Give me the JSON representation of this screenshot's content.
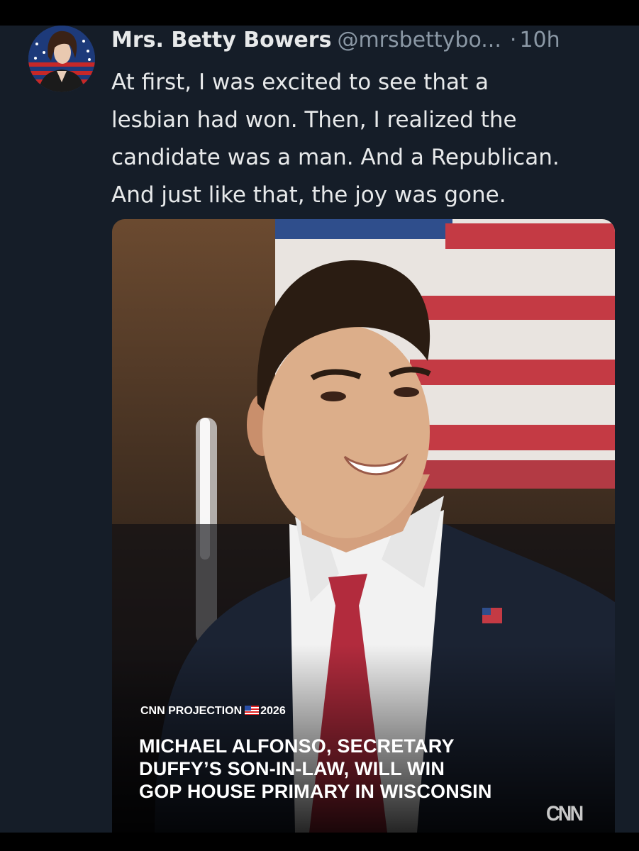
{
  "tweet": {
    "author": {
      "display_name": "Mrs. Betty Bowers",
      "handle": "@mrsbettybo...",
      "separator": "·",
      "time": "10h"
    },
    "text_lines": [
      "At first, I was excited to see that a",
      "lesbian had won. Then, I realized the",
      "candidate was a man. And a Republican.",
      "And just like that, the joy was gone."
    ],
    "media": {
      "projection_label": "CNN PROJECTION",
      "projection_year": "2026",
      "headline_lines": [
        "MICHAEL ALFONSO, SECRETARY",
        "DUFFY’S SON-IN-LAW, WILL WIN",
        "GOP HOUSE PRIMARY IN WISCONSIN"
      ],
      "logo_text": "CNN"
    }
  },
  "colors": {
    "background": "#151d28",
    "text_primary": "#e7e9ea",
    "text_secondary": "#8b98a5"
  }
}
